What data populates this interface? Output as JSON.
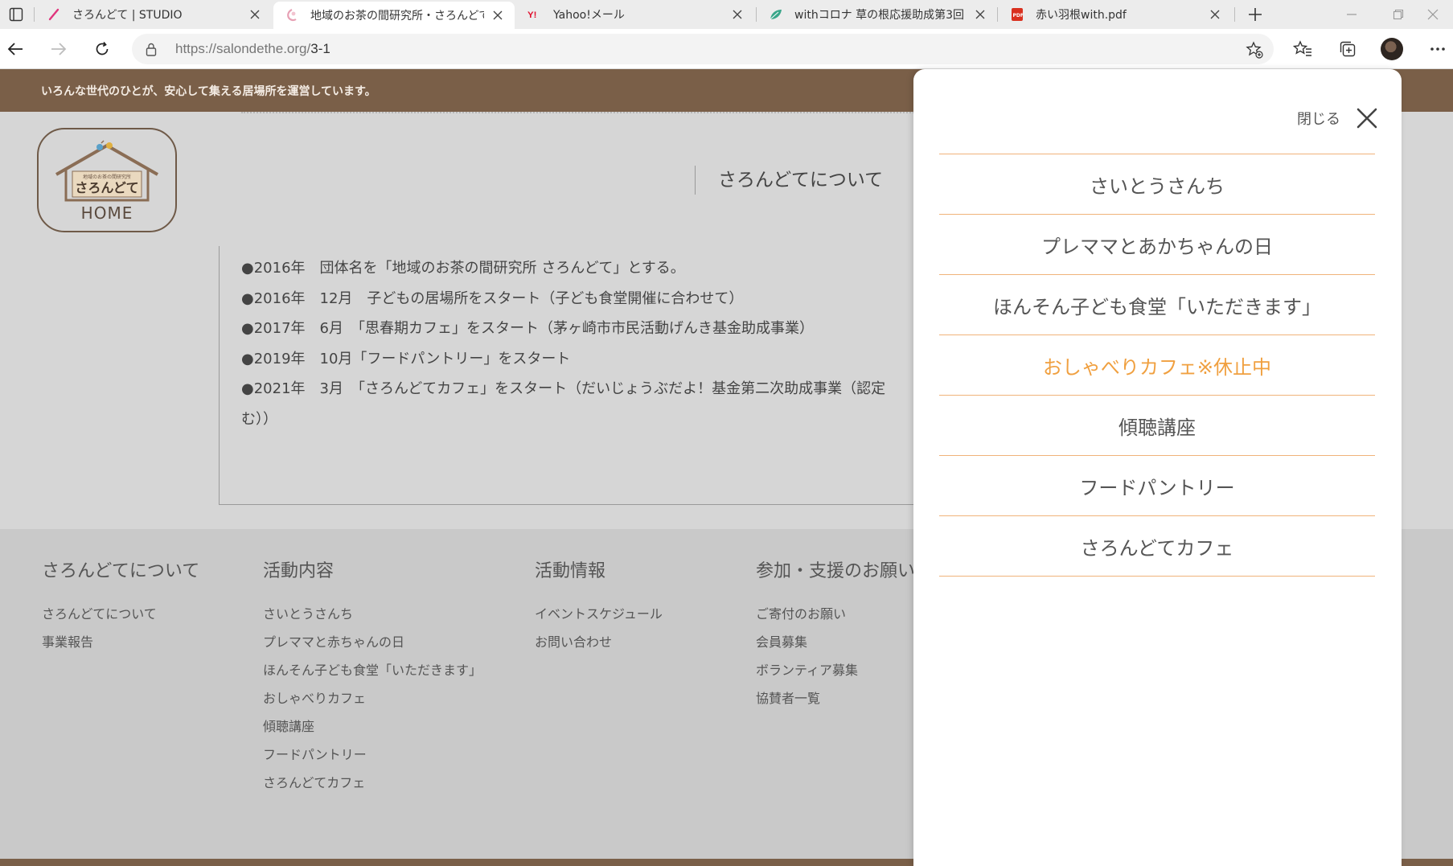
{
  "browser": {
    "tabs": [
      {
        "title": "さろんどて | STUDIO",
        "favicon": "studio-icon",
        "active": false
      },
      {
        "title": "地域のお茶の間研究所・さろんどて",
        "favicon": "saron-icon",
        "active": true
      },
      {
        "title": "Yahoo!メール",
        "favicon": "yahoo-icon",
        "active": false
      },
      {
        "title": "withコロナ 草の根応援助成第3回",
        "favicon": "leaf-icon",
        "active": false
      },
      {
        "title": "赤い羽根with.pdf",
        "favicon": "pdf-icon",
        "active": false
      }
    ],
    "url_host": "https://salondethe.org/",
    "url_path": "3-1"
  },
  "page": {
    "tagline": "いろんな世代のひとが、安心して集える居場所を運営しています。",
    "logo": {
      "home_label": "HOME",
      "logo_small": "地域のお茶の間研究所",
      "logo_name": "さろんどて"
    },
    "about_heading": "さろんどてについて",
    "history": [
      "●2016年　団体名を「地域のお茶の間研究所 さろんどて」とする。",
      "●2016年　12月　子どもの居場所をスタート（子ども食堂開催に合わせて）",
      "●2017年　6月　「思春期カフェ」をスタート（茅ヶ崎市市民活動げんき基金助成事業）",
      "●2019年　10月「フードパントリー」をスタート",
      "●2021年　3月　「さろんどてカフェ」をスタート（だいじょうぶだよ！基金第二次助成事業（認定"
    ],
    "history_continued": "む））"
  },
  "footer": {
    "columns": [
      {
        "heading": "さろんどてについて",
        "links": [
          "さろんどてについて",
          "事業報告"
        ]
      },
      {
        "heading": "活動内容",
        "links": [
          "さいとうさんち",
          "プレママと赤ちゃんの日",
          "ほんそん子ども食堂「いただきます」",
          "おしゃべりカフェ",
          "傾聴講座",
          "フードパントリー",
          "さろんどてカフェ"
        ]
      },
      {
        "heading": "活動情報",
        "links": [
          "イベントスケジュール",
          "お問い合わせ"
        ]
      },
      {
        "heading": "参加・支援のお願い",
        "links": [
          "ご寄付のお願い",
          "会員募集",
          "ボランティア募集",
          "協賛者一覧"
        ]
      }
    ]
  },
  "menu": {
    "close_label": "閉じる",
    "items": [
      {
        "label": "さいとうさんち",
        "current": false
      },
      {
        "label": "プレママとあかちゃんの日",
        "current": false
      },
      {
        "label": "ほんそん子ども食堂「いただきます」",
        "current": false
      },
      {
        "label": "おしゃべりカフェ※休止中",
        "current": true
      },
      {
        "label": "傾聴講座",
        "current": false
      },
      {
        "label": "フードパントリー",
        "current": false
      },
      {
        "label": "さろんどてカフェ",
        "current": false
      }
    ]
  },
  "colors": {
    "brand_brown": "#7a5f48",
    "menu_accent": "#f0a040",
    "menu_divider": "#f0b37a",
    "overlay_gray": "#d6d6d6"
  }
}
